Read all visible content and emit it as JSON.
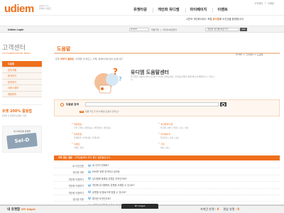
{
  "header": {
    "logo": "udiem",
    "logo_sub_1": "season 2",
    "logo_sub_2": "플레이 유앤드",
    "util_links": [
      "고객센터",
      "도움말"
    ],
    "nav": [
      {
        "label": "유젯타운",
        "active": false
      },
      {
        "label": "개인화 유디엠",
        "active": false
      },
      {
        "label": "마이페이지",
        "active": false
      },
      {
        "label": "이벤트",
        "active": false
      }
    ],
    "promo_text": "나만의 개인화서비스 포털",
    "promo_highlight": "유디엠",
    "promo_text_2": "에 오신것을 환영합니다!"
  },
  "loginbar": {
    "label": "Udiem Login",
    "username_placeholder": "ID/PW",
    "links": [
      "회원가입",
      "아이디/비번찾기"
    ],
    "quick_select": "개인화 유디엠 바로가기",
    "go_label": "GO"
  },
  "sidebar": {
    "title": "고객센터",
    "subtitle": "CUSTOMERCENTER MENU",
    "items": [
      {
        "label": "도움말",
        "active": true
      },
      {
        "label": "공지사항",
        "active": false
      },
      {
        "label": "문의하기",
        "active": false
      },
      {
        "label": "문의하기",
        "active": false
      },
      {
        "label": "서비스정보",
        "active": false
      },
      {
        "label": "제휴문의",
        "active": false
      }
    ],
    "banner1_title_a": "유젯",
    "banner1_title_b": "200% 활용법",
    "banner1_text": "유젯을 더 즐겁게 사용하는 방법",
    "banner2_top": "내 사이트에 유젯을",
    "banner2_badge": "Sel-D"
  },
  "main": {
    "title": "도움말",
    "notice_prefix": "유젯",
    "notice_bold": "200% 활용법",
    "notice_text": " : 유젯을 내 블로그, 카페, 홈페이지에 담아 보셨나요?",
    "breadcrumb": "HOME > 고객센터 > 도움말",
    "hero_title": "유디엠 도움말센터",
    "hero_desc": "유디엠을 이용하시면서 궁금하신 사항을 찾아보세요. 자주묻는질문을 통해 빠르게 해결하실 수 있습니다.",
    "search_label": "도움말 검색",
    "search_value": "",
    "tip_tag": "TIP",
    "tip_text": "회원가입 할 때 이메일 인증이 안되요?",
    "categories": [
      {
        "title": "회원정보",
        "sub": "가입 | 탈퇴 | 회원정보 | 비밀번호 | 개인정보"
      },
      {
        "title": "유젯타운",
        "sub": "유젯등록 | 유젯이용 | 유젯관리"
      },
      {
        "title": "개인화유디엠",
        "sub": "유디엠 | 메인 | 위젯 | 스킨 | 설정"
      },
      {
        "title": "마이페이지",
        "sub": "즐겨찾기 | 관심 | 정보"
      },
      {
        "title": "이벤트",
        "sub": "이벤트 참여"
      },
      {
        "title": "기타",
        "sub": "제휴 | 광고"
      }
    ],
    "faq_header": "자주 묻는 질문",
    "faq_header_text": " - 고객님들께서 자주 묻는 질문들입니다.",
    "faq": [
      {
        "category": "로그인/인증",
        "question": "로그인이 안돼요?"
      },
      {
        "category": "유디엠 이용",
        "question": "RSS를 위젯 추가하고 싶어요"
      },
      {
        "category": "개인화 이용하기",
        "question": "유디엠에 등록된 유젯은 무엇인가요?"
      },
      {
        "category": "개인화 이용하기",
        "question": "개인화 유디엠에서 유젯을 삭제할 수 있나요?"
      },
      {
        "category": "개인화 이용하기",
        "question": "유젯을 내 블로그에 담을 수 있나요?"
      },
      {
        "category": "유디엠 이용",
        "question": "탭이란 무엇인가요?"
      },
      {
        "category": "개인화 이용하기",
        "question": "유젯들의 위치를 바꾸고 싶어요"
      }
    ]
  },
  "udget": {
    "title": "내 유젯함",
    "sub": "MY Udget",
    "tab_label": "MY Udget",
    "right_label_1": "가져간 유젯 :",
    "right_value_1": "0",
    "right_label_2": "관심 유젯 :",
    "right_value_2": "0"
  }
}
